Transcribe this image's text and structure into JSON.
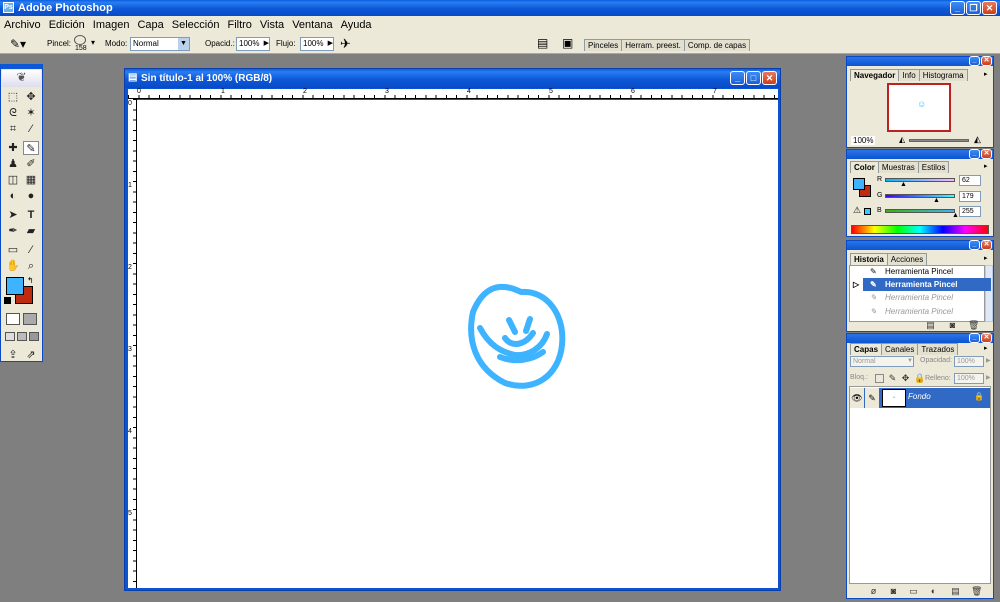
{
  "app": {
    "title": "Adobe Photoshop"
  },
  "menu": [
    "Archivo",
    "Edición",
    "Imagen",
    "Capa",
    "Selección",
    "Filtro",
    "Vista",
    "Ventana",
    "Ayuda"
  ],
  "options": {
    "pincel_label": "Pincel:",
    "brush_size": "158",
    "modo_label": "Modo:",
    "modo_value": "Normal",
    "opacidad_label": "Opacid.:",
    "opacidad_value": "100%",
    "flujo_label": "Flujo:",
    "flujo_value": "100%"
  },
  "well_tabs": [
    "Pinceles",
    "Herram. preest.",
    "Comp. de capas"
  ],
  "document": {
    "title": "Sin título-1 al 100% (RGB/8)",
    "ruler_h": [
      "0",
      "1",
      "2",
      "3",
      "4",
      "5",
      "6",
      "7"
    ],
    "ruler_v": [
      "0",
      "1",
      "2",
      "3",
      "4",
      "5"
    ]
  },
  "navigator": {
    "tabs": [
      "Navegador",
      "Info",
      "Histograma"
    ],
    "zoom": "100%"
  },
  "color": {
    "tabs": [
      "Color",
      "Muestras",
      "Estilos"
    ],
    "r_label": "R",
    "g_label": "G",
    "b_label": "B",
    "r": "62",
    "g": "179",
    "b": "255",
    "fg_color": "#3eb3ff",
    "bg_color": "#c02a0e"
  },
  "history": {
    "tabs": [
      "Historia",
      "Acciones"
    ],
    "items": [
      "Herramienta Pincel",
      "Herramienta Pincel",
      "Herramienta Pincel",
      "Herramienta Pincel"
    ]
  },
  "layers": {
    "tabs": [
      "Capas",
      "Canales",
      "Trazados"
    ],
    "blend": "Normal",
    "opacity_label": "Opacidad:",
    "opacity": "100%",
    "lock_label": "Bloq.:",
    "fill_label": "Relleno:",
    "fill": "100%",
    "layer_name": "Fondo"
  }
}
